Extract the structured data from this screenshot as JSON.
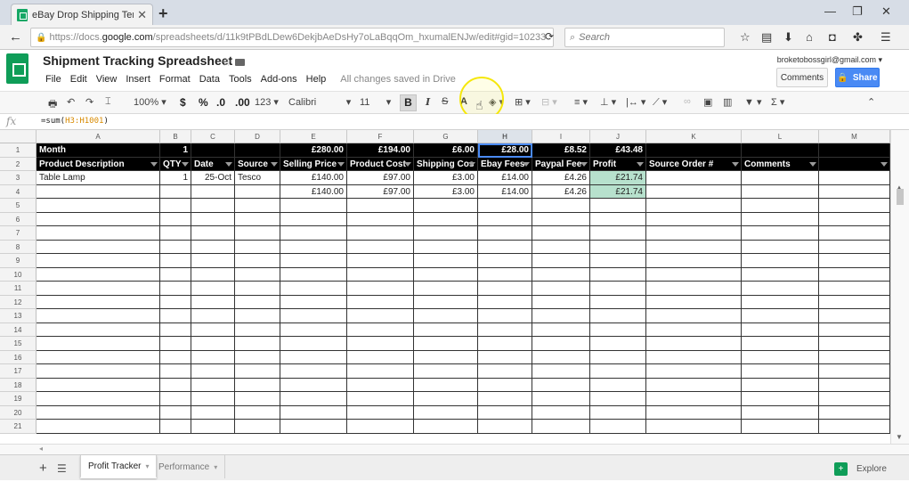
{
  "browser": {
    "tab_title": "eBay Drop Shipping Templa",
    "url_prefix": "https://docs.",
    "url_host": "google.com",
    "url_path": "/spreadsheets/d/11k9tPBdLDew6DekjbAeDsHy7oLaBqqOm_hxumalENJw/edit#gid=10233",
    "search_placeholder": "Search"
  },
  "doc": {
    "title": "Shipment Tracking Spreadsheet",
    "menu": [
      "File",
      "Edit",
      "View",
      "Insert",
      "Format",
      "Data",
      "Tools",
      "Add-ons",
      "Help"
    ],
    "save_status": "All changes saved in Drive",
    "user_email": "broketobossgirl@gmail.com",
    "comments_label": "Comments",
    "share_label": "Share"
  },
  "toolbar": {
    "zoom": "100%",
    "currency": "$",
    "percent": "%",
    "decimal_less": ".0",
    "decimal_more": ".00",
    "more_formats": "123",
    "font": "Calibri",
    "font_size": "11",
    "bold": "B",
    "italic": "I",
    "strike": "S",
    "text_color": "A",
    "sigma": "Σ"
  },
  "formula_bar": {
    "prefix": "=sum(",
    "ref": "H3:H1001",
    "suffix": ")"
  },
  "sheet": {
    "col_letters": [
      "A",
      "B",
      "C",
      "D",
      "E",
      "F",
      "G",
      "H",
      "I",
      "J",
      "K",
      "L",
      "M"
    ],
    "selected_col": "H",
    "row_numbers": [
      "1",
      "2",
      "3",
      "4",
      "5",
      "6",
      "7",
      "8",
      "9",
      "10",
      "11",
      "12",
      "13",
      "14",
      "15",
      "16",
      "17",
      "18",
      "19",
      "20",
      "21"
    ],
    "summary_row": [
      "Month",
      "1",
      "",
      "",
      "£280.00",
      "£194.00",
      "£6.00",
      "£28.00",
      "£8.52",
      "£43.48",
      "",
      "",
      ""
    ],
    "headers": [
      "Product Description",
      "QTY",
      "Date",
      "Source",
      "Selling Price",
      "Product Cost",
      "Shipping Cos",
      "Ebay Fees",
      "Paypal Fee",
      "Profit",
      "Source Order #",
      "Comments",
      ""
    ],
    "rows": [
      [
        "Table Lamp",
        "1",
        "25-Oct",
        "Tesco",
        "£140.00",
        "£97.00",
        "£3.00",
        "£14.00",
        "£4.26",
        "£21.74",
        "",
        "",
        ""
      ],
      [
        "",
        "",
        "",
        "",
        "£140.00",
        "£97.00",
        "£3.00",
        "£14.00",
        "£4.26",
        "£21.74",
        "",
        "",
        ""
      ]
    ]
  },
  "sheet_tabs": {
    "tabs": [
      "Profit Tracker",
      "Performance"
    ],
    "active": 0,
    "explore_label": "Explore"
  }
}
